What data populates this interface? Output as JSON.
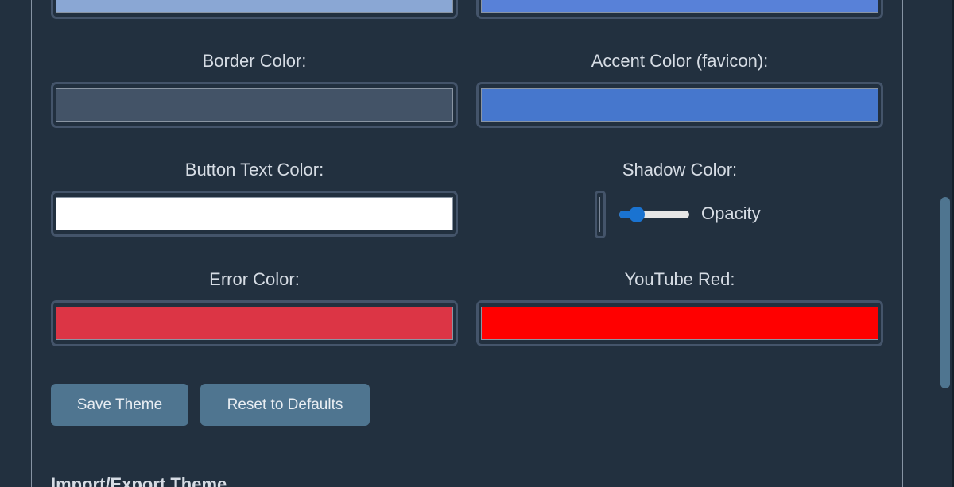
{
  "colors": {
    "top_left_swatch": "#8aa7d4",
    "top_right_swatch": "#5881d8",
    "border_color": "#435367",
    "accent_color": "#4677cd",
    "button_text_color": "#ffffff",
    "error_color": "#dc3545",
    "youtube_red": "#ff0000",
    "button_bg": "#4f7590",
    "slider_accent": "#1a73d1"
  },
  "fields": {
    "border_color_label": "Border Color:",
    "accent_color_label": "Accent Color (favicon):",
    "button_text_color_label": "Button Text Color:",
    "shadow_color_label": "Shadow Color:",
    "error_color_label": "Error Color:",
    "youtube_red_label": "YouTube Red:"
  },
  "shadow": {
    "opacity_label": "Opacity",
    "opacity_value": 0.18
  },
  "actions": {
    "save_label": "Save Theme",
    "reset_label": "Reset to Defaults"
  },
  "import_export": {
    "heading": "Import/Export Theme"
  }
}
